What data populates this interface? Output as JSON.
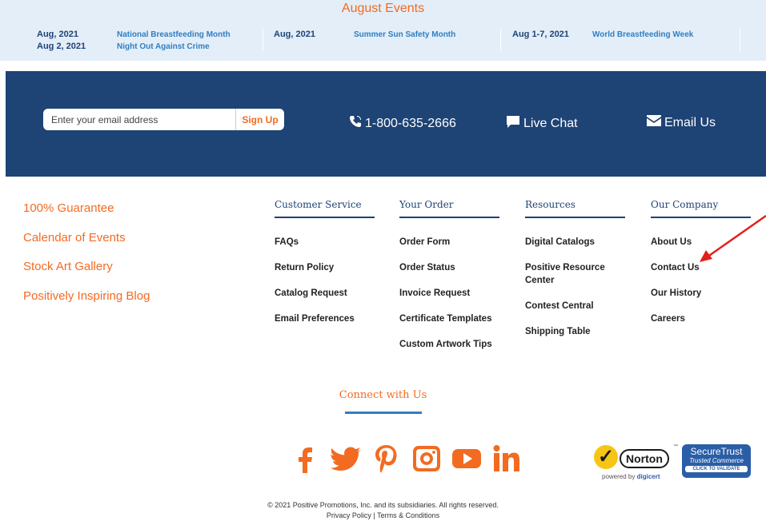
{
  "events": {
    "title": "August Events",
    "blocks": [
      {
        "dates": [
          "Aug, 2021",
          "Aug 2, 2021"
        ],
        "names": [
          "National Breastfeeding Month",
          "Night Out Against Crime"
        ]
      },
      {
        "dates": [
          "Aug, 2021"
        ],
        "names": [
          "Summer Sun Safety Month"
        ]
      },
      {
        "dates": [
          "Aug 1-7, 2021"
        ],
        "names": [
          "World Breastfeeding Week"
        ]
      }
    ]
  },
  "band": {
    "email_placeholder": "Enter your email address",
    "signup_label": "Sign Up",
    "phone": "1-800-635-2666",
    "live_chat": "Live Chat",
    "email_us": "Email Us"
  },
  "left_links": [
    "100% Guarantee",
    "Calendar of Events",
    "Stock Art Gallery",
    "Positively Inspiring Blog"
  ],
  "columns": [
    {
      "title": "Customer Service",
      "items": [
        "FAQs",
        "Return Policy",
        "Catalog Request",
        "Email Preferences"
      ]
    },
    {
      "title": "Your Order",
      "items": [
        "Order Form",
        "Order Status",
        "Invoice Request",
        "Certificate Templates",
        "Custom Artwork Tips"
      ]
    },
    {
      "title": "Resources",
      "items": [
        "Digital Catalogs",
        "Positive Resource Center",
        "Contest Central",
        "Shipping Table"
      ]
    },
    {
      "title": "Our Company",
      "items": [
        "About Us",
        "Contact Us",
        "Our History",
        "Careers"
      ]
    }
  ],
  "connect": {
    "title": "Connect with Us",
    "social_icons": [
      "facebook-icon",
      "twitter-icon",
      "pinterest-icon",
      "instagram-icon",
      "youtube-icon",
      "linkedin-icon"
    ]
  },
  "badges": {
    "norton_word": "Norton",
    "norton_tm": "™",
    "norton_powered": "powered by",
    "norton_digicert": "digicert",
    "st_title": "SecureTrust",
    "st_sub": "Trusted Commerce",
    "st_validate": "CLICK TO VALIDATE"
  },
  "footer": {
    "copyright": "© 2021 Positive Promotions, Inc. and its subsidiaries. All rights reserved.",
    "privacy": "Privacy Policy",
    "divider": "|",
    "terms": "Terms & Conditions"
  },
  "colors": {
    "accent": "#f26b21",
    "navy": "#1e4375",
    "link_blue": "#2f7ec2",
    "annotation_arrow": "#e0201a"
  }
}
